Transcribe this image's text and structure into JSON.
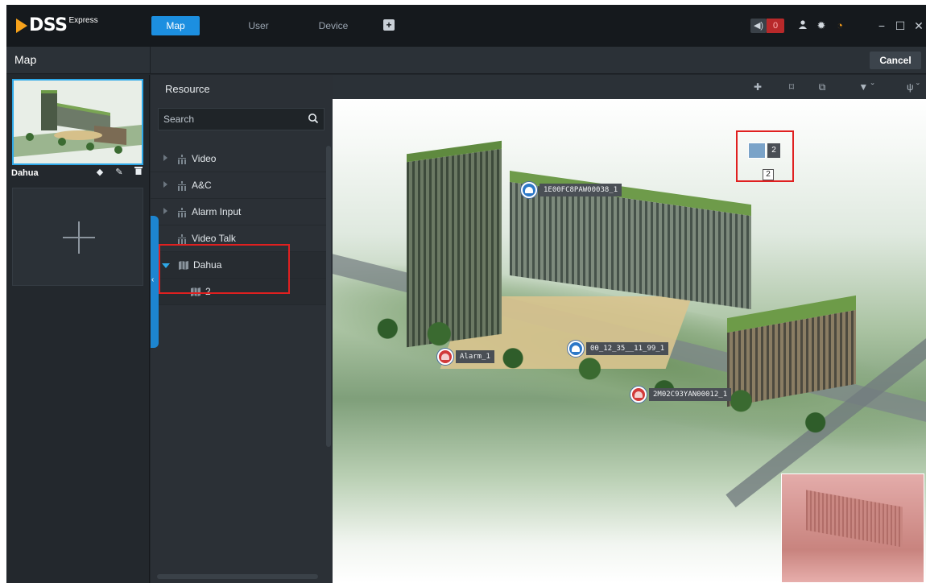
{
  "app": {
    "logo_text": "DSS",
    "logo_sub": "Express"
  },
  "nav": {
    "tabs": [
      {
        "label": "Map",
        "active": true
      },
      {
        "label": "User",
        "active": false
      },
      {
        "label": "Device",
        "active": false
      }
    ],
    "add_tab_icon": "+"
  },
  "topbar": {
    "alarm_count": "0",
    "icons": [
      "sound-icon",
      "user-icon",
      "gear-icon",
      "performance-icon"
    ],
    "window_controls": [
      "−",
      "☐",
      "✕"
    ]
  },
  "subbar": {
    "title": "Map",
    "cancel_label": "Cancel"
  },
  "map_list": {
    "items": [
      {
        "name": "Dahua"
      }
    ],
    "add_icon": "plus-icon"
  },
  "resource": {
    "title": "Resource",
    "search_placeholder": "Search",
    "tree": [
      {
        "label": "Video",
        "expanded": false
      },
      {
        "label": "A&C",
        "expanded": false
      },
      {
        "label": "Alarm Input",
        "expanded": false
      },
      {
        "label": "Video Talk",
        "expanded": false
      },
      {
        "label": "Dahua",
        "expanded": true
      },
      {
        "label": "2",
        "child": true
      }
    ]
  },
  "map": {
    "devices": [
      {
        "label": "1E00FC8PAW00038_1",
        "kind": "camera"
      },
      {
        "label": "Alarm_1",
        "kind": "alarm"
      },
      {
        "label": "00_12_35__11_99_1",
        "kind": "door"
      },
      {
        "label": "2M02C93YAN00012_1",
        "kind": "alarm"
      }
    ],
    "submap_hotspot": {
      "badge": "2",
      "name": "2"
    }
  },
  "colors": {
    "accent": "#1c8fe0",
    "highlight_box": "#e02020",
    "alarm_badge": "#b8292a"
  }
}
